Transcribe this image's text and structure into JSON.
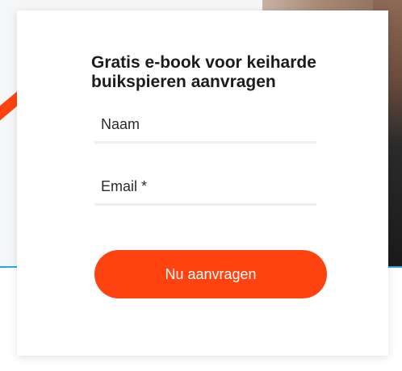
{
  "form": {
    "title": "Gratis e-book voor keiharde buikspieren aanvragen",
    "name_placeholder": "Naam",
    "email_placeholder": "Email *",
    "submit_label": "Nu aanvragen"
  },
  "colors": {
    "accent": "#ff4310",
    "divider": "#29a8e0",
    "field_underline": "#eeeeee"
  }
}
